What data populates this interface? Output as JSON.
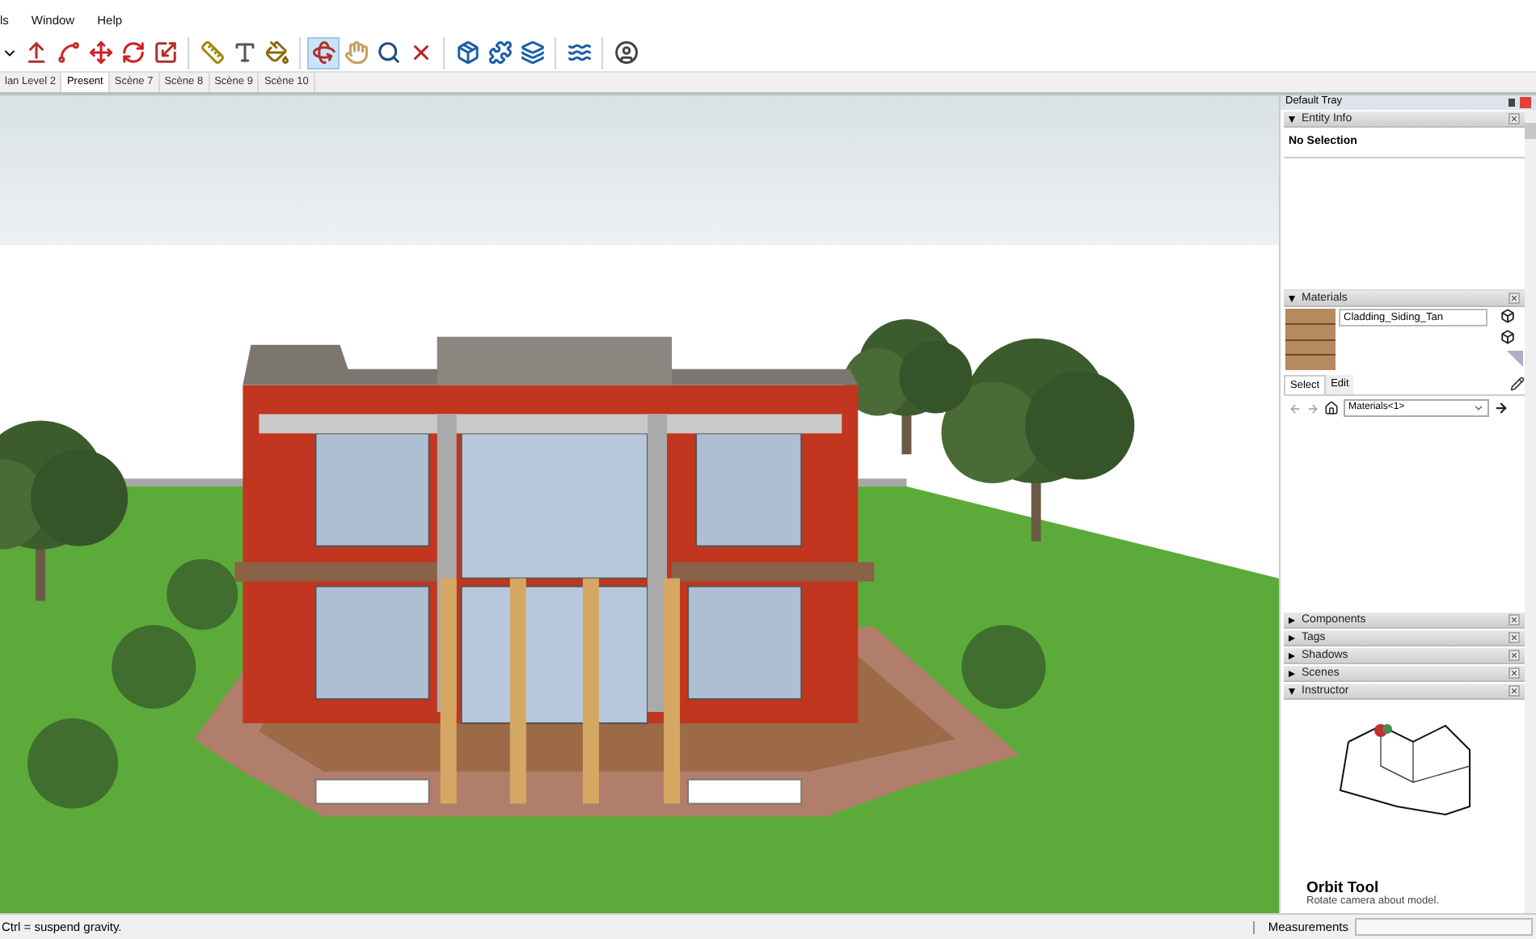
{
  "menu": [
    "ls",
    "Window",
    "Help"
  ],
  "tools": [
    {
      "kind": "caret",
      "selected": false
    },
    {
      "kind": "push",
      "selected": false
    },
    {
      "kind": "follow",
      "selected": false
    },
    {
      "kind": "move",
      "selected": false
    },
    {
      "kind": "rotate",
      "selected": false
    },
    {
      "kind": "scale",
      "selected": false
    },
    {
      "kind": "sep"
    },
    {
      "kind": "tape",
      "selected": false
    },
    {
      "kind": "text",
      "selected": false
    },
    {
      "kind": "paint",
      "selected": false
    },
    {
      "kind": "sep"
    },
    {
      "kind": "orbit",
      "selected": true
    },
    {
      "kind": "pan",
      "selected": false
    },
    {
      "kind": "zoom",
      "selected": false
    },
    {
      "kind": "extents",
      "selected": false
    },
    {
      "kind": "sep"
    },
    {
      "kind": "warehouse",
      "selected": false
    },
    {
      "kind": "extension",
      "selected": false
    },
    {
      "kind": "layers",
      "selected": false
    },
    {
      "kind": "sep"
    },
    {
      "kind": "sandbox",
      "selected": false
    },
    {
      "kind": "sep"
    },
    {
      "kind": "account",
      "selected": false
    }
  ],
  "scene_tabs": [
    {
      "label": "lan Level 2",
      "selected": false
    },
    {
      "label": "Present",
      "selected": true
    },
    {
      "label": "Scène 7",
      "selected": false
    },
    {
      "label": "Scène 8",
      "selected": false
    },
    {
      "label": "Scène 9",
      "selected": false
    },
    {
      "label": "Scène 10",
      "selected": false
    }
  ],
  "tray": {
    "title": "Default Tray",
    "entity_info": {
      "title": "Entity Info",
      "expanded": true,
      "text": "No Selection"
    },
    "materials": {
      "title": "Materials",
      "expanded": true,
      "name": "Cladding_Siding_Tan",
      "tabs": [
        {
          "label": "Select",
          "selected": true
        },
        {
          "label": "Edit",
          "selected": false
        }
      ],
      "library": "Materials<1>"
    },
    "panels": [
      {
        "title": "Components",
        "expanded": false
      },
      {
        "title": "Tags",
        "expanded": false
      },
      {
        "title": "Shadows",
        "expanded": false
      },
      {
        "title": "Scenes",
        "expanded": false
      },
      {
        "title": "Instructor",
        "expanded": true
      }
    ],
    "instructor": {
      "title": "Orbit Tool",
      "description": "Rotate camera about model."
    }
  },
  "status_bar": {
    "hint": "Ctrl = suspend gravity.",
    "measurements_label": "Measurements"
  }
}
